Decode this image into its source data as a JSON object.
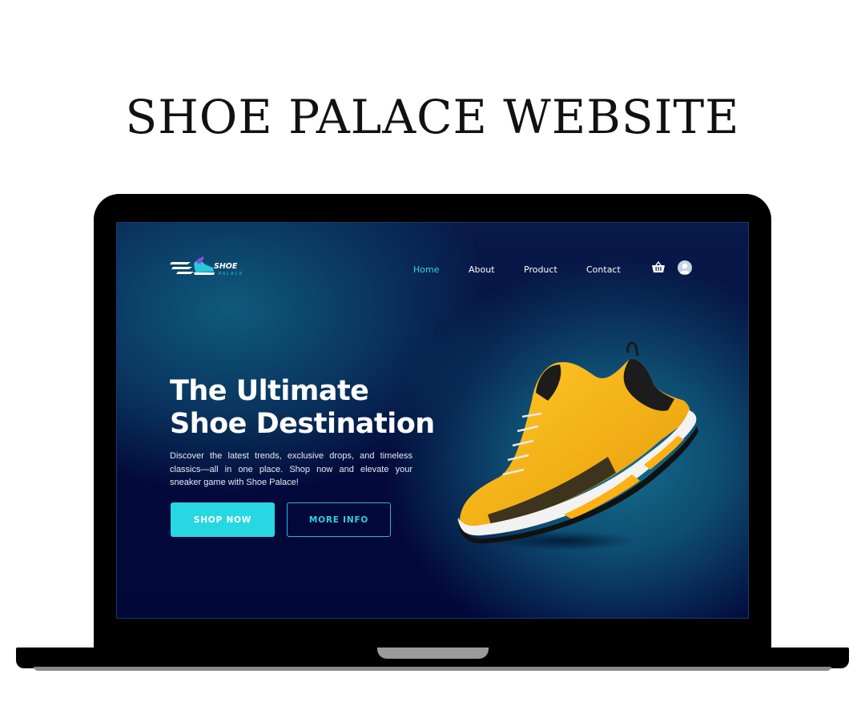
{
  "page_title": "SHOE PALACE WEBSITE",
  "site": {
    "logo": {
      "line1": "SHOE",
      "line2": "PALACE"
    },
    "nav": {
      "items": [
        {
          "label": "Home",
          "active": true
        },
        {
          "label": "About",
          "active": false
        },
        {
          "label": "Product",
          "active": false
        },
        {
          "label": "Contact",
          "active": false
        }
      ],
      "icons": [
        "cart-icon",
        "user-avatar-icon"
      ]
    },
    "hero": {
      "title_line1": "The Ultimate",
      "title_line2": "Shoe Destination",
      "description": "Discover the latest trends, exclusive drops, and timeless classics—all in one place. Shop now and elevate your sneaker game with Shoe Palace!",
      "primary_button": "SHOP NOW",
      "secondary_button": "MORE INFO"
    }
  },
  "colors": {
    "accent": "#27d8e3",
    "background_dark": "#030a3a",
    "background_teal": "#146f8e",
    "shoe_yellow": "#f6b71a"
  }
}
